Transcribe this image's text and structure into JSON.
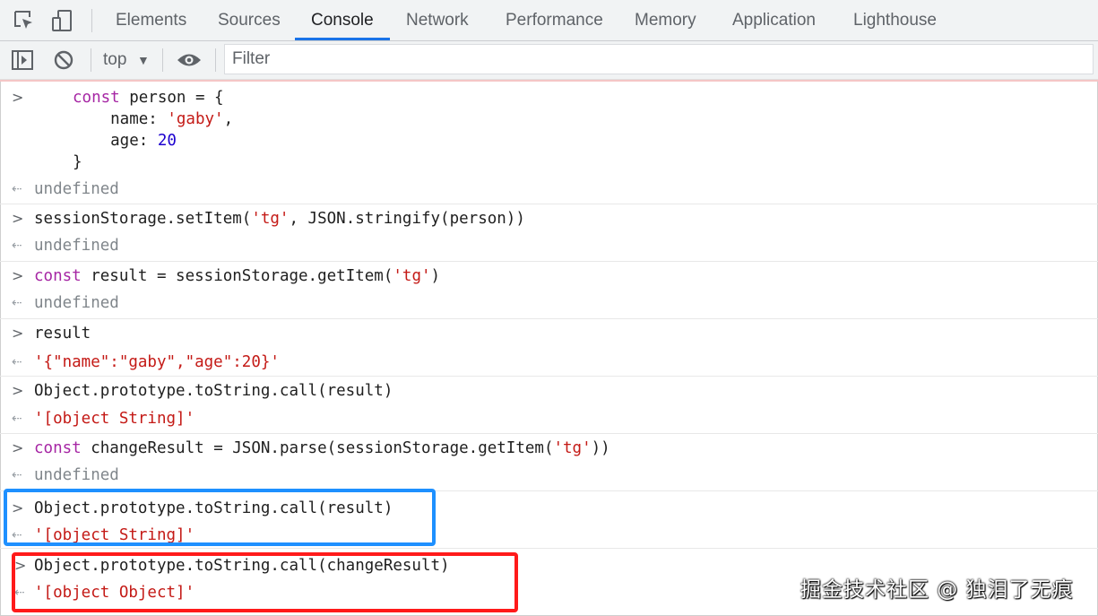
{
  "tabs": [
    "Elements",
    "Sources",
    "Console",
    "Network",
    "Performance",
    "Memory",
    "Application",
    "Lighthouse"
  ],
  "active_tab": "Console",
  "toolbar": {
    "context": "top",
    "filter_placeholder": "Filter"
  },
  "console": {
    "e1": {
      "l1": "const",
      "l1b": " person = {",
      "l2a": "    name: ",
      "l2b": "'gaby'",
      "l2c": ",",
      "l3a": "    age: ",
      "l3b": "20",
      "l4": "}",
      "ret": "undefined"
    },
    "e2": {
      "a": "sessionStorage.setItem(",
      "b": "'tg'",
      "c": ", JSON.stringify(person))",
      "ret": "undefined"
    },
    "e3": {
      "kw": "const",
      "a": " result = sessionStorage.getItem(",
      "b": "'tg'",
      "c": ")",
      "ret": "undefined"
    },
    "e4": {
      "a": "result",
      "ret": "'{\"name\":\"gaby\",\"age\":20}'"
    },
    "e5": {
      "a": "Object.prototype.toString.call(result)",
      "ret": "'[object String]'"
    },
    "e6": {
      "kw": "const",
      "a": " changeResult = JSON.parse(sessionStorage.getItem(",
      "b": "'tg'",
      "c": "))",
      "ret": "undefined"
    },
    "e7": {
      "a": "Object.prototype.toString.call(result)",
      "ret": "'[object String]'"
    },
    "e8": {
      "a": "Object.prototype.toString.call(changeResult)",
      "ret": "'[object Object]'"
    }
  },
  "watermark": "掘金技术社区 @ 独泪了无痕",
  "colors": {
    "highlight_blue": "#1e90ff",
    "highlight_red": "#ff1a1a",
    "tab_underline": "#1a73e8"
  }
}
